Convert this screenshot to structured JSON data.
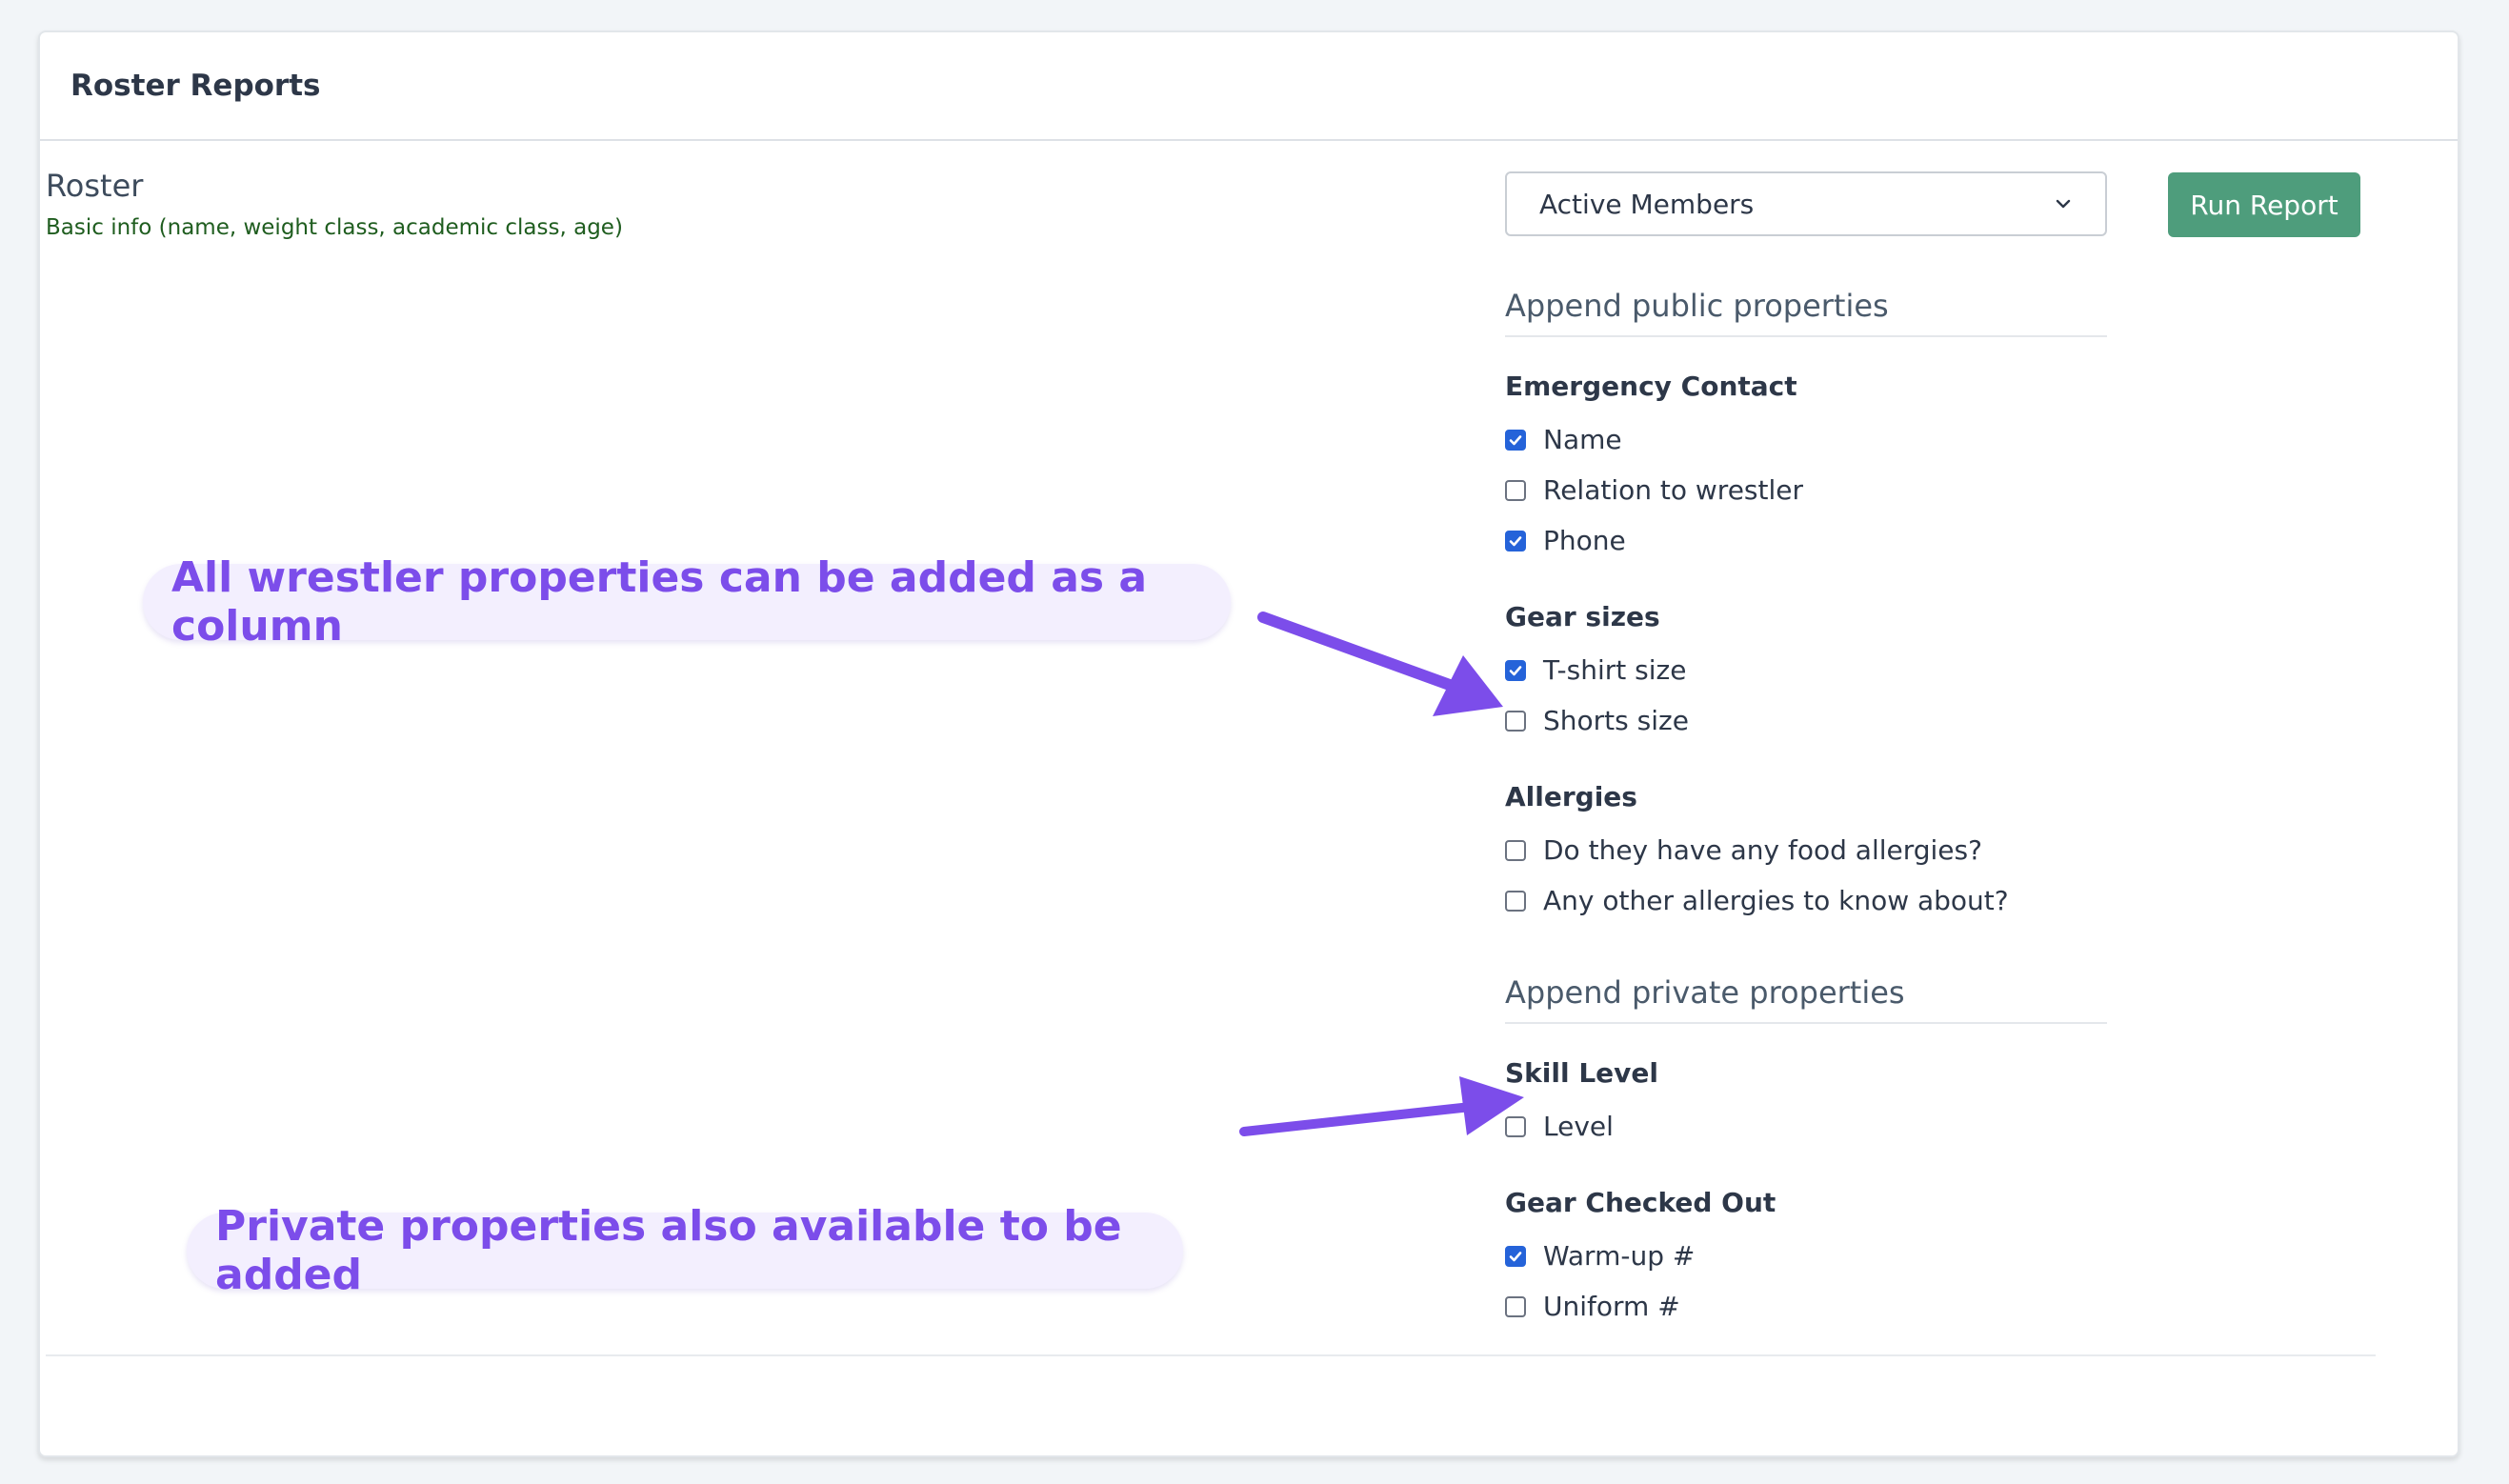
{
  "card": {
    "title": "Roster Reports"
  },
  "report": {
    "title": "Roster",
    "description": "Basic info (name, weight class, academic class, age)"
  },
  "controls": {
    "select_value": "Active Members",
    "run_label": "Run Report"
  },
  "public": {
    "title": "Append public properties",
    "groups": [
      {
        "title": "Emergency Contact",
        "items": [
          {
            "label": "Name",
            "checked": true
          },
          {
            "label": "Relation to wrestler",
            "checked": false
          },
          {
            "label": "Phone",
            "checked": true
          }
        ]
      },
      {
        "title": "Gear sizes",
        "items": [
          {
            "label": "T-shirt size",
            "checked": true
          },
          {
            "label": "Shorts size",
            "checked": false
          }
        ]
      },
      {
        "title": "Allergies",
        "items": [
          {
            "label": "Do they have any food allergies?",
            "checked": false
          },
          {
            "label": "Any other allergies to know about?",
            "checked": false
          }
        ]
      }
    ]
  },
  "private": {
    "title": "Append private properties",
    "groups": [
      {
        "title": "Skill Level",
        "items": [
          {
            "label": "Level",
            "checked": false
          }
        ]
      },
      {
        "title": "Gear Checked Out",
        "items": [
          {
            "label": "Warm-up #",
            "checked": true
          },
          {
            "label": "Uniform #",
            "checked": false
          }
        ]
      }
    ]
  },
  "annotations": {
    "callout_public": "All wrestler properties can be added as a column",
    "callout_private": "Private properties also available to be added"
  },
  "colors": {
    "accent": "#7c4dea",
    "run_button": "#4e9d7c",
    "checkbox_checked": "#2563d9",
    "description_text": "#1f5d1f"
  }
}
